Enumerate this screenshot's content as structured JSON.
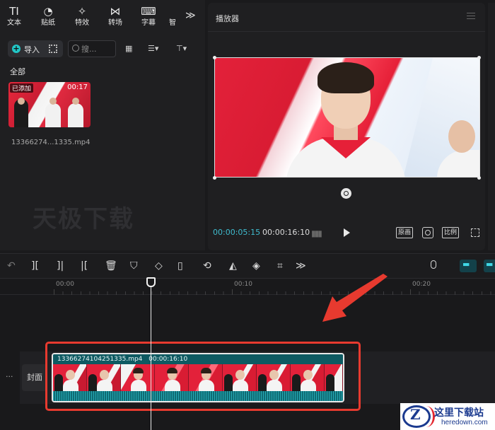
{
  "toolbar": {
    "items": [
      {
        "label": "文本",
        "glyph": "TI"
      },
      {
        "label": "贴纸",
        "glyph": "◔"
      },
      {
        "label": "特效",
        "glyph": "✧"
      },
      {
        "label": "转场",
        "glyph": "⋈"
      },
      {
        "label": "字幕",
        "glyph": "⌨"
      },
      {
        "label": "智",
        "glyph": ""
      }
    ],
    "more_glyph": "≫"
  },
  "media": {
    "import_label": "导入",
    "search_placeholder": "搜...",
    "all_label": "全部",
    "clip": {
      "badge": "已添加",
      "duration": "00:17",
      "filename": "13366274...1335.mp4"
    }
  },
  "watermark": "天极下载",
  "player": {
    "title": "播放器",
    "current_time": "00:00:05:15",
    "total_time": "00:00:16:10",
    "original_label": "原画",
    "ratio_label": "比例"
  },
  "timeline": {
    "ticks": [
      "00:00",
      "00:10",
      "00:20"
    ],
    "cover_label": "封面",
    "track_menu": "···",
    "clip_name": "13366274104251335.mp4",
    "clip_duration": "00:00:16:10"
  },
  "logo": {
    "cn": "这里下载站",
    "en": "heredown.com"
  },
  "colors": {
    "accent": "#3fbccf",
    "clip_teal": "#0f6b73",
    "highlight_red": "#e73a2f"
  }
}
